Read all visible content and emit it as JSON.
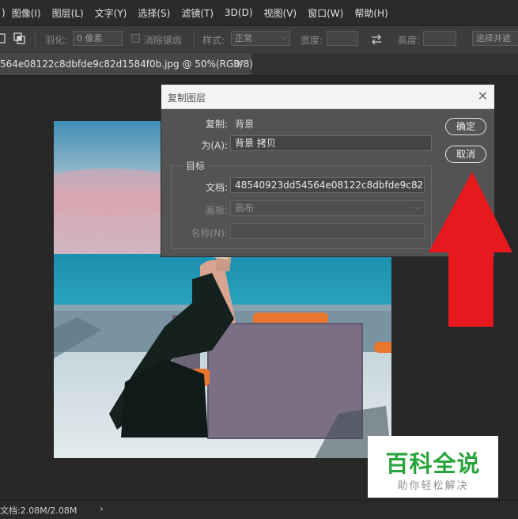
{
  "menu": [
    "图像(I)",
    "图层(L)",
    "文字(Y)",
    "选择(S)",
    "滤镜(T)",
    "3D(D)",
    "视图(V)",
    "窗口(W)",
    "帮助(H)"
  ],
  "menu_lead": ")",
  "options": {
    "feather_label": "羽化:",
    "feather_value": "0 像素",
    "antialias_label": "消除锯齿",
    "style_label": "样式:",
    "style_value": "正常",
    "width_label": "宽度:",
    "height_label": "高度:",
    "select_mask_label": "选择并遮"
  },
  "tab": {
    "label": "564e08122c8dbfde9c82d1584f0b.jpg @ 50%(RGB/8)",
    "close": "×"
  },
  "dialog": {
    "title": "复制图层",
    "close": "×",
    "copy_label": "复制:",
    "copy_value": "背景",
    "as_label": "为(A):",
    "as_value": "背景 拷贝",
    "group_label": "目标",
    "doc_label": "文档:",
    "doc_value": "48540923dd54564e08122c8dbfde9c82...",
    "board_label": "画板:",
    "board_value": "画布",
    "name_label": "名称(N):",
    "name_value": "",
    "ok": "确定",
    "cancel": "取消"
  },
  "status": {
    "text": "文档:2.08M/2.08M",
    "chevron": "›"
  },
  "watermark": {
    "title": "百科全说",
    "subtitle": "助你轻松解决"
  },
  "colors": {
    "arrow": "#e8181f",
    "watermark_green": "#2aa43c"
  }
}
